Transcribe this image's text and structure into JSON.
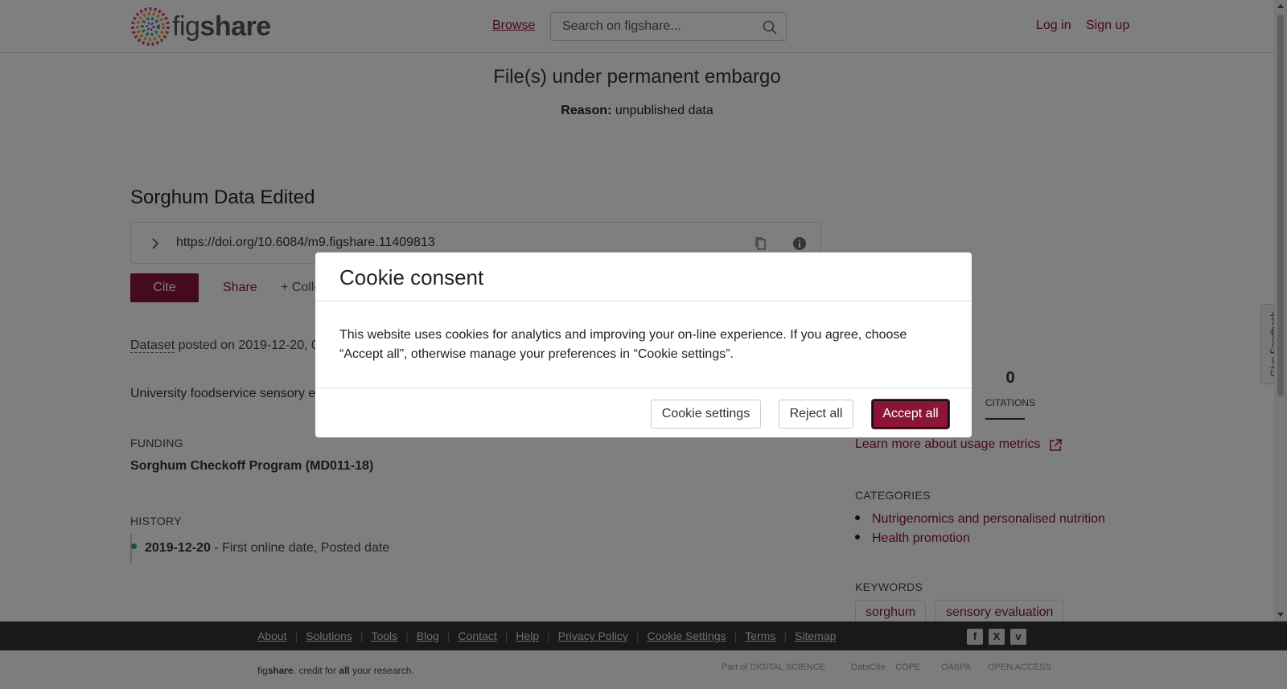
{
  "header": {
    "logo_text_light": "fig",
    "logo_text_bold": "share",
    "browse": "Browse",
    "search_placeholder": "Search on figshare...",
    "login": "Log in",
    "signup": "Sign up"
  },
  "embargo": {
    "title": "File(s) under permanent embargo",
    "reason_label": "Reason:",
    "reason_value": "unpublished data"
  },
  "item": {
    "title": "Sorghum Data Edited",
    "doi": "https://doi.org/10.6084/m9.figshare.11409813",
    "cite": "Cite",
    "share": "Share",
    "collect": "+ Colle",
    "type": "Dataset",
    "posted_prefix": "posted on 2019-12-20, 0",
    "description": "University foodservice sensory e",
    "funding_label": "FUNDING",
    "funding_value": "Sorghum Checkoff Program (MD011-18)",
    "history_label": "HISTORY",
    "history_date": "2019-12-20",
    "history_text": " - First online date, Posted date"
  },
  "metrics": {
    "citations_count": "0",
    "citations_label": "CITATIONS",
    "learn_more": "Learn more about usage metrics"
  },
  "categories": {
    "label": "CATEGORIES",
    "items": [
      "Nutrigenomics and personalised nutrition",
      "Health promotion"
    ]
  },
  "keywords": {
    "label": "KEYWORDS",
    "items": [
      "sorghum",
      "sensory evaluation"
    ]
  },
  "feedback": "Give Feedback",
  "footer": {
    "links": [
      "About",
      "Solutions",
      "Tools",
      "Blog",
      "Contact",
      "Help",
      "Privacy Policy",
      "Cookie Settings",
      "Terms",
      "Sitemap"
    ],
    "tag_light": "fig",
    "tag_bold": "share",
    "tag_mid": ". credit for ",
    "tag_bold2": "all",
    "tag_end": " your research.",
    "partners": [
      "Part of DIGITAL SCIENCE",
      "DataCite",
      "COPE",
      "OASPA",
      "OPEN ACCESS"
    ]
  },
  "cookie": {
    "title": "Cookie consent",
    "body": "This website uses cookies for analytics and improving your on-line experience. If you agree, choose “Accept all”, otherwise manage your preferences in “Cookie settings”.",
    "settings": "Cookie settings",
    "reject": "Reject all",
    "accept": "Accept all"
  },
  "colors": {
    "brand": "#8a1538",
    "overlay": "rgba(0,0,0,0.5)",
    "footer_dark": "#333333"
  }
}
